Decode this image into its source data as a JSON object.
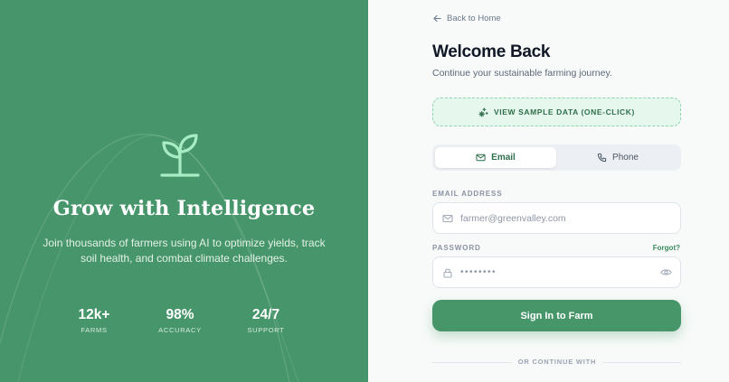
{
  "hero": {
    "title": "Grow with Intelligence",
    "subtitle": "Join thousands of farmers using AI to optimize yields, track soil health, and combat climate challenges.",
    "stats": [
      {
        "value": "12k+",
        "label": "FARMS"
      },
      {
        "value": "98%",
        "label": "ACCURACY"
      },
      {
        "value": "24/7",
        "label": "SUPPORT"
      }
    ],
    "icon": "sprout-icon"
  },
  "nav": {
    "back_label": "Back to Home"
  },
  "form": {
    "title": "Welcome Back",
    "subtitle": "Continue your sustainable farming journey.",
    "sample_button": "VIEW SAMPLE DATA (ONE-CLICK)",
    "tabs": [
      {
        "label": "Email",
        "active": true
      },
      {
        "label": "Phone",
        "active": false
      }
    ],
    "email_label": "EMAIL ADDRESS",
    "email_value": "farmer@greenvalley.com",
    "password_label": "PASSWORD",
    "forgot_label": "Forgot?",
    "password_value": "••••••••",
    "submit_label": "Sign In to Farm",
    "divider_label": "OR CONTINUE WITH"
  },
  "colors": {
    "brand_green": "#47966b",
    "accent_green": "#2f6f4b",
    "title": "#111827"
  }
}
